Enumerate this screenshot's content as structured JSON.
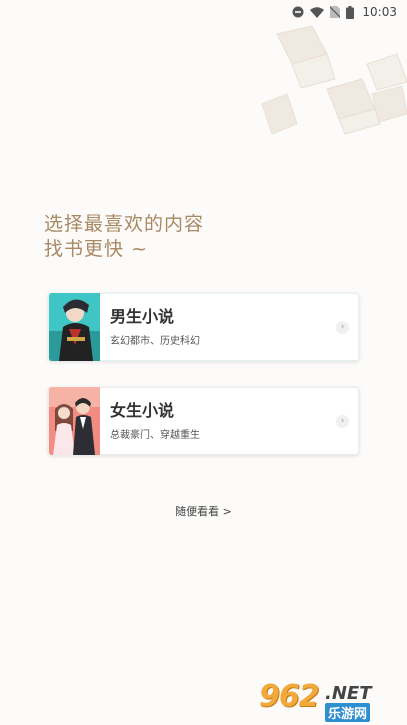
{
  "status_bar": {
    "time": "10:03",
    "icons": [
      "do-not-disturb-icon",
      "wifi-icon",
      "no-sim-icon",
      "battery-icon"
    ]
  },
  "headline": {
    "line1": "选择最喜欢的内容",
    "line2": "找书更快 ~"
  },
  "cards": [
    {
      "title": "男生小说",
      "subtitle": "玄幻都市、历史科幻",
      "icon": "chevron-right-icon"
    },
    {
      "title": "女生小说",
      "subtitle": "总裁豪门、穿越重生",
      "icon": "chevron-right-icon"
    }
  ],
  "browse_label": "随便看看 >",
  "watermark": {
    "brand": "962",
    "suffix": ".NET",
    "cn": "乐游网"
  },
  "colors": {
    "background": "#fcfbfa",
    "headline": "#a88963",
    "male_accent": "#3fc6c4",
    "female_accent": "#f28b82"
  }
}
